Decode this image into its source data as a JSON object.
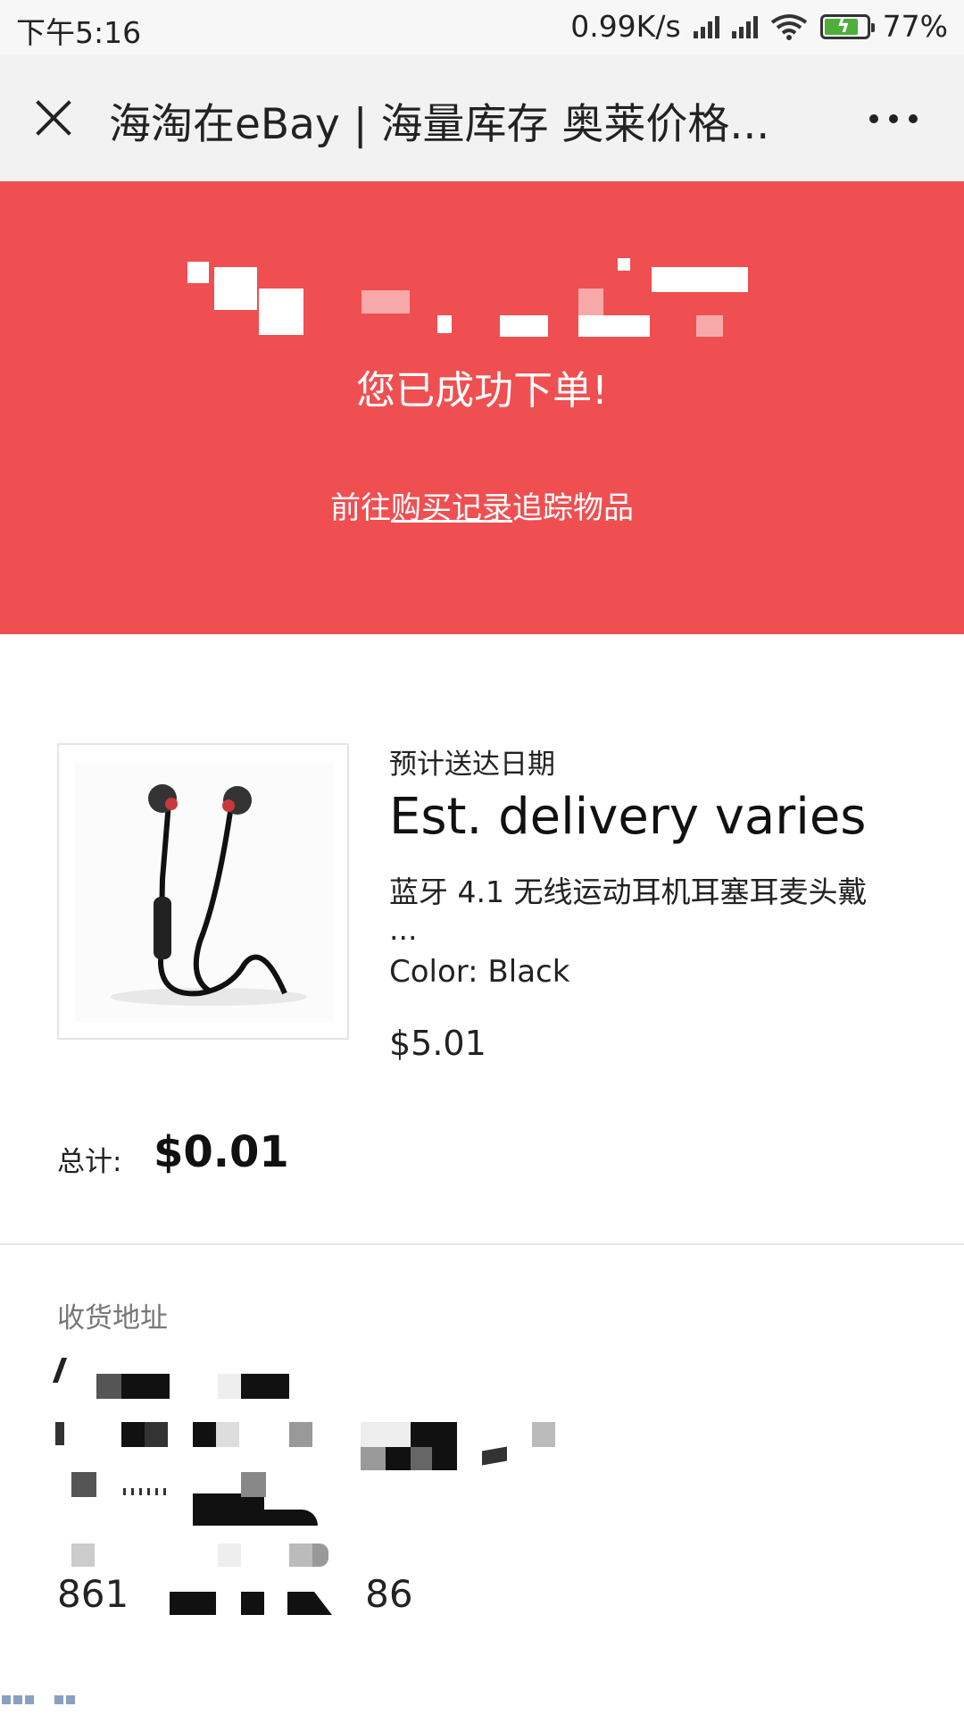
{
  "status_bar": {
    "time": "下午5:16",
    "net_speed": "0.99K/s",
    "battery": "77%",
    "icons": [
      "signal-icon",
      "signal-icon",
      "wifi-icon",
      "battery-charging-icon"
    ]
  },
  "title_bar": {
    "title": "海淘在eBay | 海量库存 奥莱价格...",
    "close_icon": "close-icon",
    "more_icon": "more-icon"
  },
  "banner": {
    "color": "#f04f51",
    "success_text": "您已成功下单!",
    "track_prefix": "前往",
    "track_link": "购买记录",
    "track_suffix": "追踪物品"
  },
  "item": {
    "delivery_label": "预计送达日期",
    "delivery_value": "Est. delivery varies",
    "title": "蓝牙 4.1 无线运动耳机耳塞耳麦头戴",
    "title_ellipsis": "...",
    "color": "Color: Black",
    "price": "$5.01"
  },
  "total": {
    "label": "总计:",
    "value": "$0.01"
  },
  "address": {
    "label": "收货地址",
    "phone_start": "861",
    "phone_end": "86"
  }
}
